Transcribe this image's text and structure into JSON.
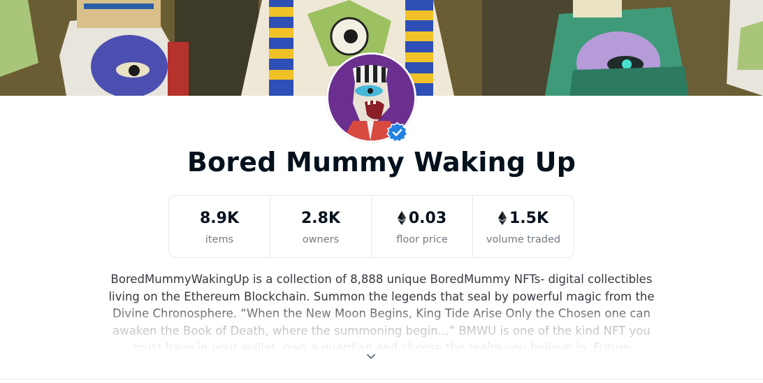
{
  "collection": {
    "name": "Bored Mummy Waking Up",
    "verified": true
  },
  "stats": [
    {
      "value": "8.9K",
      "label": "items",
      "eth": false
    },
    {
      "value": "2.8K",
      "label": "owners",
      "eth": false
    },
    {
      "value": "0.03",
      "label": "floor price",
      "eth": true
    },
    {
      "value": "1.5K",
      "label": "volume traded",
      "eth": true
    }
  ],
  "description": "BoredMummyWakingUp is a collection of 8,888 unique BoredMummy NFTs- digital collectibles living on the Ethereum Blockchain. Summon the legends that seal by powerful magic from the Divine Chronosphere. “When the New Moon Begins, King Tide Arise Only the Chosen one can awaken the Book of Death, where the summoning begin...” BMWU is one of the kind NFT you must have in your wallet, own a guardian and choose the realm you believe in. Future",
  "icons": {
    "verified": "verified-badge-icon",
    "eth": "ethereum-icon",
    "expand": "chevron-down-icon"
  },
  "colors": {
    "verified_blue": "#2081e2",
    "text_primary": "#04111d",
    "text_secondary": "#707a83",
    "border": "#e5e8eb"
  }
}
